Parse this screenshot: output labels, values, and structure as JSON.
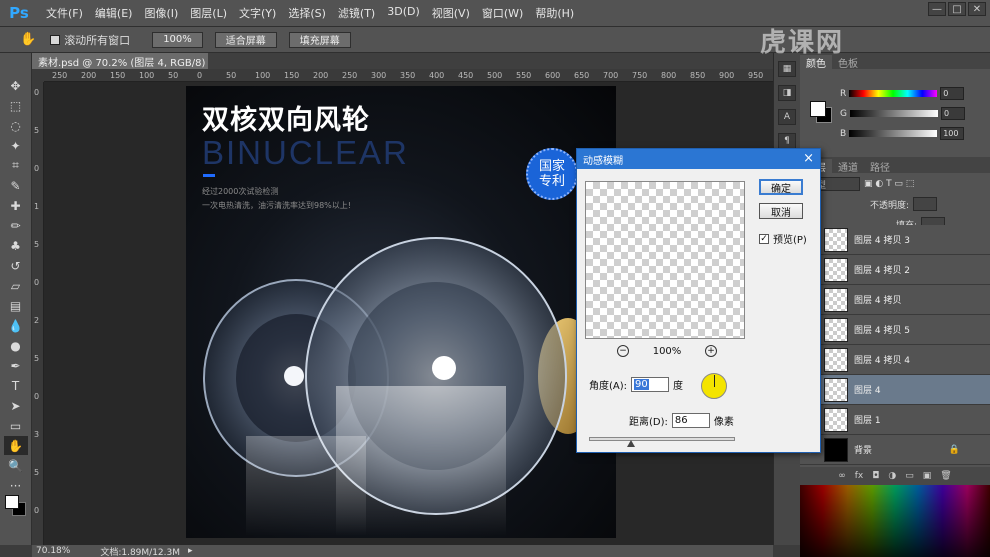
{
  "app": {
    "logo": "Ps",
    "menu": [
      "文件(F)",
      "编辑(E)",
      "图像(I)",
      "图层(L)",
      "文字(Y)",
      "选择(S)",
      "滤镜(T)",
      "3D(D)",
      "视图(V)",
      "窗口(W)",
      "帮助(H)"
    ],
    "window_controls": [
      "—",
      "□",
      "✕"
    ]
  },
  "options": {
    "scroll_all_label": "滚动所有窗口",
    "zoom_btn": "100%",
    "fit_screen_btn": "适合屏幕",
    "fill_screen_btn": "填充屏幕"
  },
  "document": {
    "tab_label": "素材.psd @ 70.2% (图层 4, RGB/8) *",
    "ruler_ticks": [
      "250",
      "200",
      "150",
      "100",
      "50",
      "0",
      "50",
      "100",
      "150",
      "200",
      "250",
      "300",
      "350",
      "400",
      "450",
      "500",
      "550",
      "600",
      "650",
      "700",
      "750",
      "800",
      "850",
      "900",
      "950",
      "1000"
    ],
    "vruler_ticks": [
      "0",
      "5",
      "0",
      "1",
      "5",
      "0",
      "2",
      "5",
      "0",
      "3",
      "5",
      "0"
    ]
  },
  "artwork": {
    "headline": "双核双向风轮",
    "subhead": "BINUCLEAR",
    "tagline1": "经过2000次试验检测",
    "tagline2": "一次电热清洗，油污清洗率达到98%以上!",
    "badge_line1": "国家",
    "badge_line2": "专利"
  },
  "status": {
    "zoom": "70.18%",
    "doc_info": "文档:1.89M/12.3M"
  },
  "watermark": "虎课网",
  "panels": {
    "color_tab": "颜色",
    "swatches_tab": "色板",
    "channel_r": "R",
    "channel_g": "G",
    "channel_b": "B",
    "r_value": "0",
    "g_value": "0",
    "b_value": "100",
    "layers_tabs": [
      "图层",
      "通道",
      "路径"
    ],
    "kind_label": "类型",
    "opacity_label": "不透明度:",
    "fill_label": "填充:",
    "layers": [
      {
        "name": "图层 4 拷贝 3",
        "selected": false,
        "dark": false
      },
      {
        "name": "图层 4 拷贝 2",
        "selected": false,
        "dark": false
      },
      {
        "name": "图层 4 拷贝",
        "selected": false,
        "dark": false
      },
      {
        "name": "图层 4 拷贝 5",
        "selected": false,
        "dark": false
      },
      {
        "name": "图层 4 拷贝 4",
        "selected": false,
        "dark": false
      },
      {
        "name": "图层 4",
        "selected": true,
        "dark": false
      },
      {
        "name": "图层 1",
        "selected": false,
        "dark": false
      },
      {
        "name": "背景",
        "selected": false,
        "dark": true
      }
    ],
    "footer_icons": [
      "link-icon",
      "fx-icon",
      "mask-icon",
      "adjustment-icon",
      "group-icon",
      "new-layer-icon",
      "trash-icon"
    ]
  },
  "dialog": {
    "title": "动感模糊",
    "ok": "确定",
    "cancel": "取消",
    "preview_label": "预览(P)",
    "preview_checked": "✓",
    "zoom_level": "100%",
    "angle_label": "角度(A):",
    "angle_value": "90",
    "angle_unit": "度",
    "distance_label": "距离(D):",
    "distance_value": "86",
    "distance_unit": "像素",
    "distance_fraction": 0.29
  },
  "colors": {
    "accent": "#2b76d3",
    "badge": "#1a64d8",
    "selected_layer": "#6a7a8c"
  }
}
